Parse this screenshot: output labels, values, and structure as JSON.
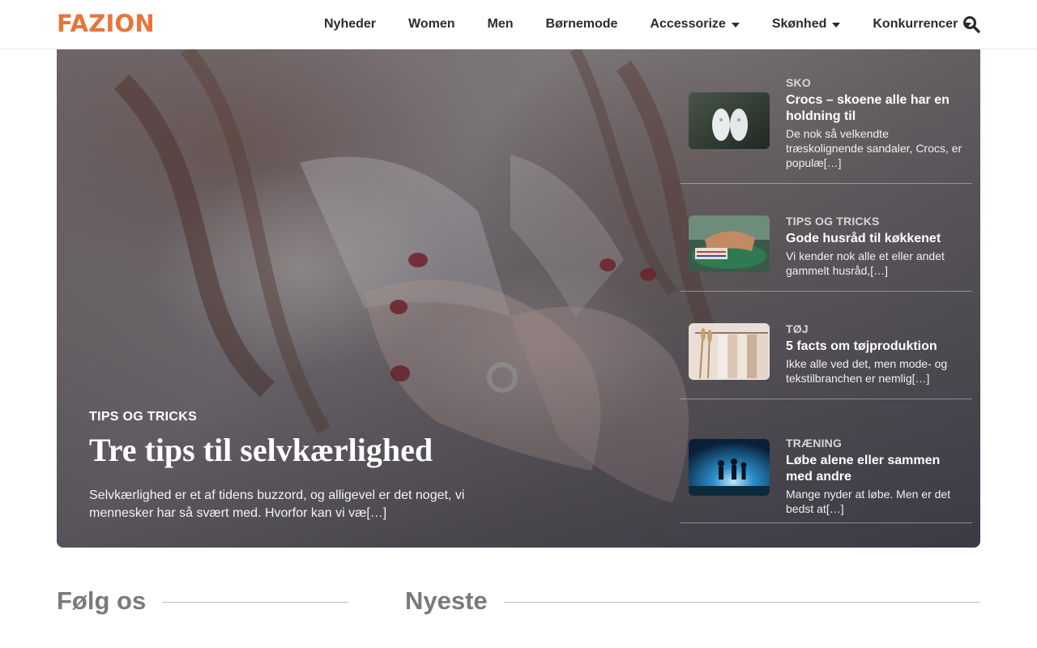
{
  "brand": {
    "logo": "FAZION",
    "accent": "#e8743b"
  },
  "nav": {
    "items": [
      {
        "label": "Nyheder",
        "has_dropdown": false
      },
      {
        "label": "Women",
        "has_dropdown": false
      },
      {
        "label": "Men",
        "has_dropdown": false
      },
      {
        "label": "Børnemode",
        "has_dropdown": false
      },
      {
        "label": "Accessorize",
        "has_dropdown": true
      },
      {
        "label": "Skønhed",
        "has_dropdown": true
      },
      {
        "label": "Konkurrencer",
        "has_dropdown": true
      }
    ],
    "search_icon": "search-icon"
  },
  "hero": {
    "category": "TIPS OG TRICKS",
    "title": "Tre tips til selvkærlighed",
    "excerpt": "Selvkærlighed er et af tidens buzzord, og alligevel er det noget, vi mennesker har så svært med. Hvorfor kan vi væ[…]"
  },
  "side_articles": [
    {
      "category": "SKO",
      "title": "Crocs – skoene alle har en holdning til",
      "excerpt": "De nok så velkendte træskolignende sandaler, Crocs, er populæ[…]",
      "thumb": "crocs-shoes-image"
    },
    {
      "category": "TIPS OG TRICKS",
      "title": "Gode husråd til køkkenet",
      "excerpt": "Vi kender nok alle et eller andet gammelt husråd,[…]",
      "thumb": "kitchen-hands-image"
    },
    {
      "category": "TØJ",
      "title": "5 facts om tøjproduktion",
      "excerpt": "Ikke alle ved det, men mode- og tekstilbranchen er nemlig[…]",
      "thumb": "clothes-rack-image"
    },
    {
      "category": "TRÆNING",
      "title": "Løbe alene eller sammen med andre",
      "excerpt": "Mange nyder at løbe. Men er det bedst at[…]",
      "thumb": "runners-image"
    }
  ],
  "sections": {
    "follow": "Følg os",
    "newest": "Nyeste"
  }
}
